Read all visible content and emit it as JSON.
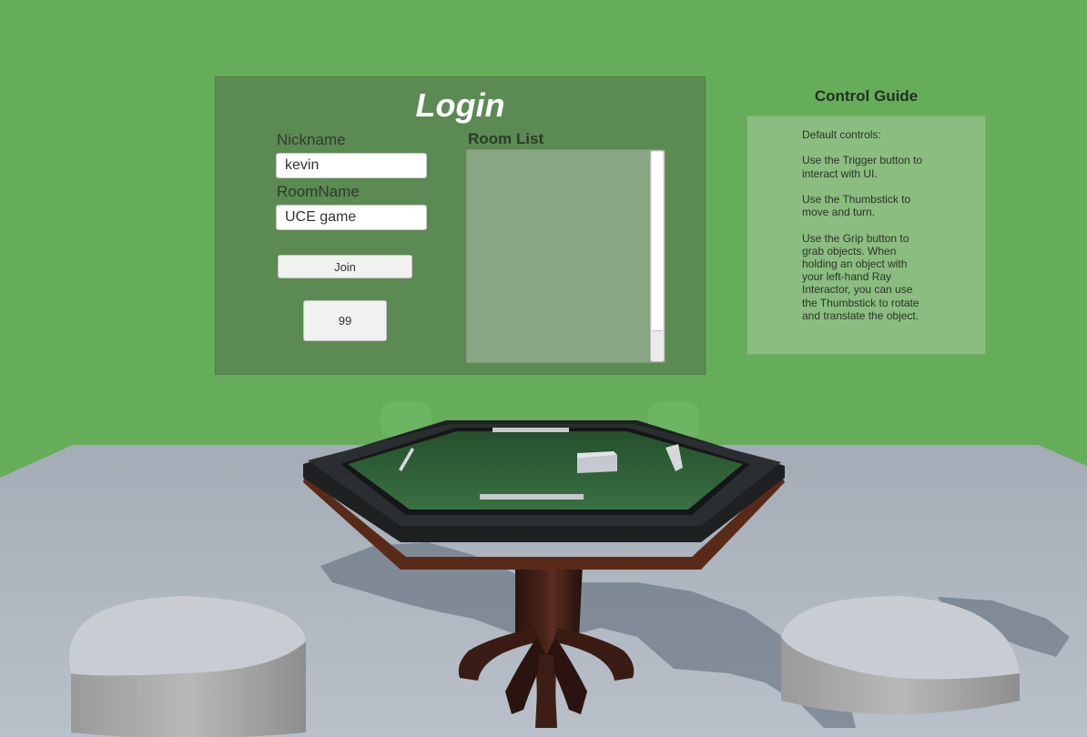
{
  "login": {
    "title": "Login",
    "nickname_label": "Nickname",
    "nickname_value": "kevin",
    "roomname_label": "RoomName",
    "roomname_value": "UCE game",
    "join_label": "Join",
    "counter_label": "99",
    "room_list_label": "Room List"
  },
  "guide": {
    "title": "Control Guide",
    "text": "Default controls:\n\nUse the Trigger button to\ninteract with UI.\n\nUse the Thumbstick to\nmove and turn.\n\nUse the Grip button to\ngrab objects. When\nholding an object with\nyour left-hand Ray\nInteractor, you can use\nthe Thumbstick to rotate\nand translate the object."
  },
  "colors": {
    "sky": "#66ad5a",
    "login_panel": "#5b8a53",
    "guide_panel": "#8abd7f",
    "floor": "#a9b2bc",
    "felt": "#2f5e37"
  }
}
